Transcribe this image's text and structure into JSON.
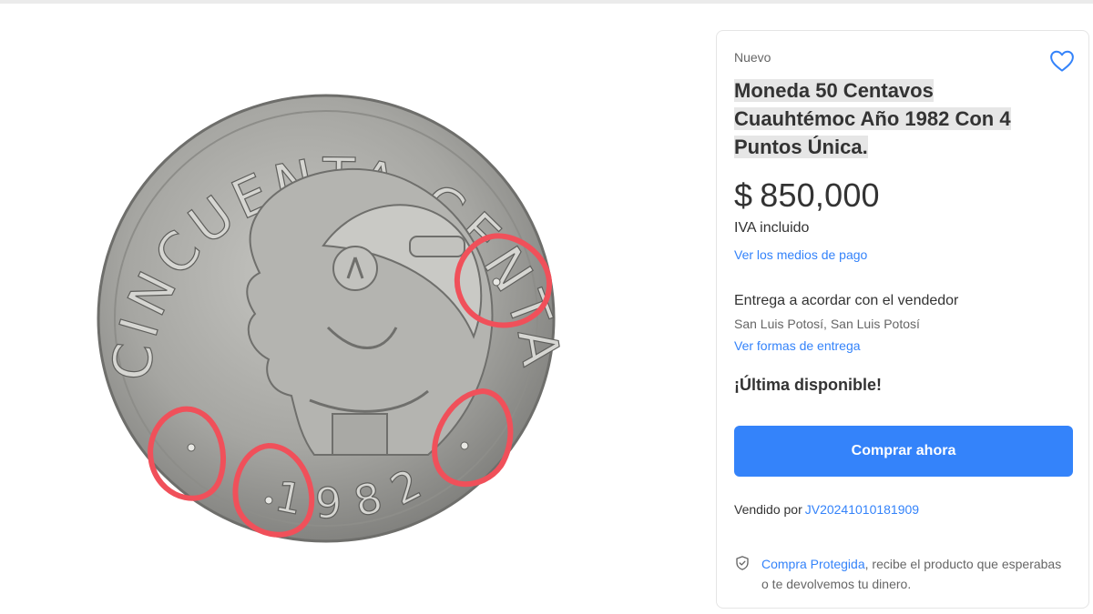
{
  "product_image": {
    "alt": "Moneda 50 centavos Cuauhtémoc",
    "coin_text_top": "CINCUENTA CENTAVOS",
    "coin_year": "1982"
  },
  "buy_box": {
    "condition": "Nuevo",
    "title": "Moneda 50 Centavos Cuauhtémoc Año 1982 Con 4 Puntos Única.",
    "price_symbol": "$",
    "price_amount": "850,000",
    "tax_note": "IVA incluido",
    "payment_link": "Ver los medios de pago",
    "delivery_title": "Entrega a acordar con el vendedor",
    "location": "San Luis Potosí, San Luis Potosí",
    "delivery_link": "Ver formas de entrega",
    "stock_note": "¡Última disponible!",
    "buy_button": "Comprar ahora",
    "seller_prefix": "Vendido por",
    "seller_name": "JV20241010181909",
    "protection_link": "Compra Protegida",
    "protection_text": ", recibe el producto que esperabas o te devolvemos tu dinero."
  },
  "icons": {
    "favorite": "heart-icon",
    "protection": "shield-check-icon"
  },
  "colors": {
    "accent": "#3483fa",
    "text": "#333333",
    "muted": "#666666",
    "annotation": "#f0505a"
  }
}
